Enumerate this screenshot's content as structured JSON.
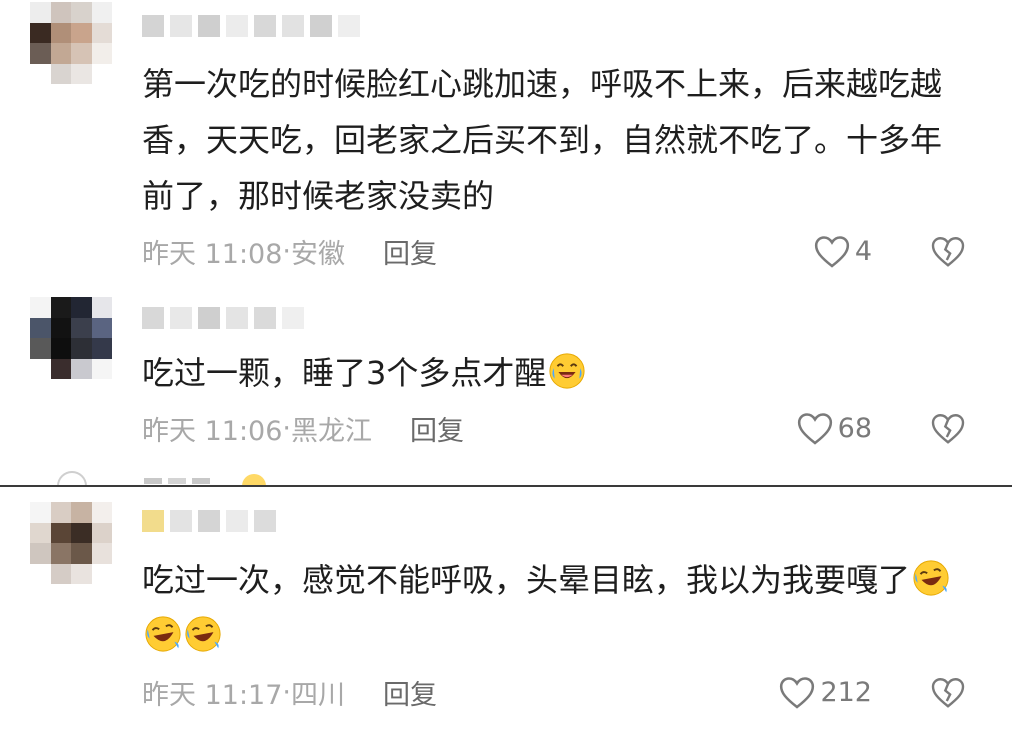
{
  "comments": [
    {
      "text": "第一次吃的时候脸红心跳加速，呼吸不上来，后来越吃越香，天天吃，回老家之后买不到，自然就不吃了。十多年前了，那时候老家没卖的",
      "time": "昨天 11:08",
      "location": "安徽",
      "reply_label": "回复",
      "likes": "4",
      "emojis": 0
    },
    {
      "text": "吃过一颗，睡了3个多点才醒",
      "time": "昨天 11:06",
      "location": "黑龙江",
      "reply_label": "回复",
      "likes": "68",
      "emojis": 1,
      "emoji_name": "laughing-crying-emoji"
    },
    {
      "text": "吃过一次，感觉不能呼吸，头晕目眩，我以为我要嘎了",
      "time": "昨天 11:17",
      "location": "四川",
      "reply_label": "回复",
      "likes": "212",
      "emojis": 3,
      "emoji_name": "rolling-laughing-emoji"
    }
  ],
  "separator": "·",
  "colors": {
    "text": "#1e1e1e",
    "meta": "#a8a8a8",
    "reply": "#6a6a6a",
    "icon": "#7a7a7a"
  },
  "icons": [
    "heart-outline-icon",
    "broken-heart-icon"
  ]
}
